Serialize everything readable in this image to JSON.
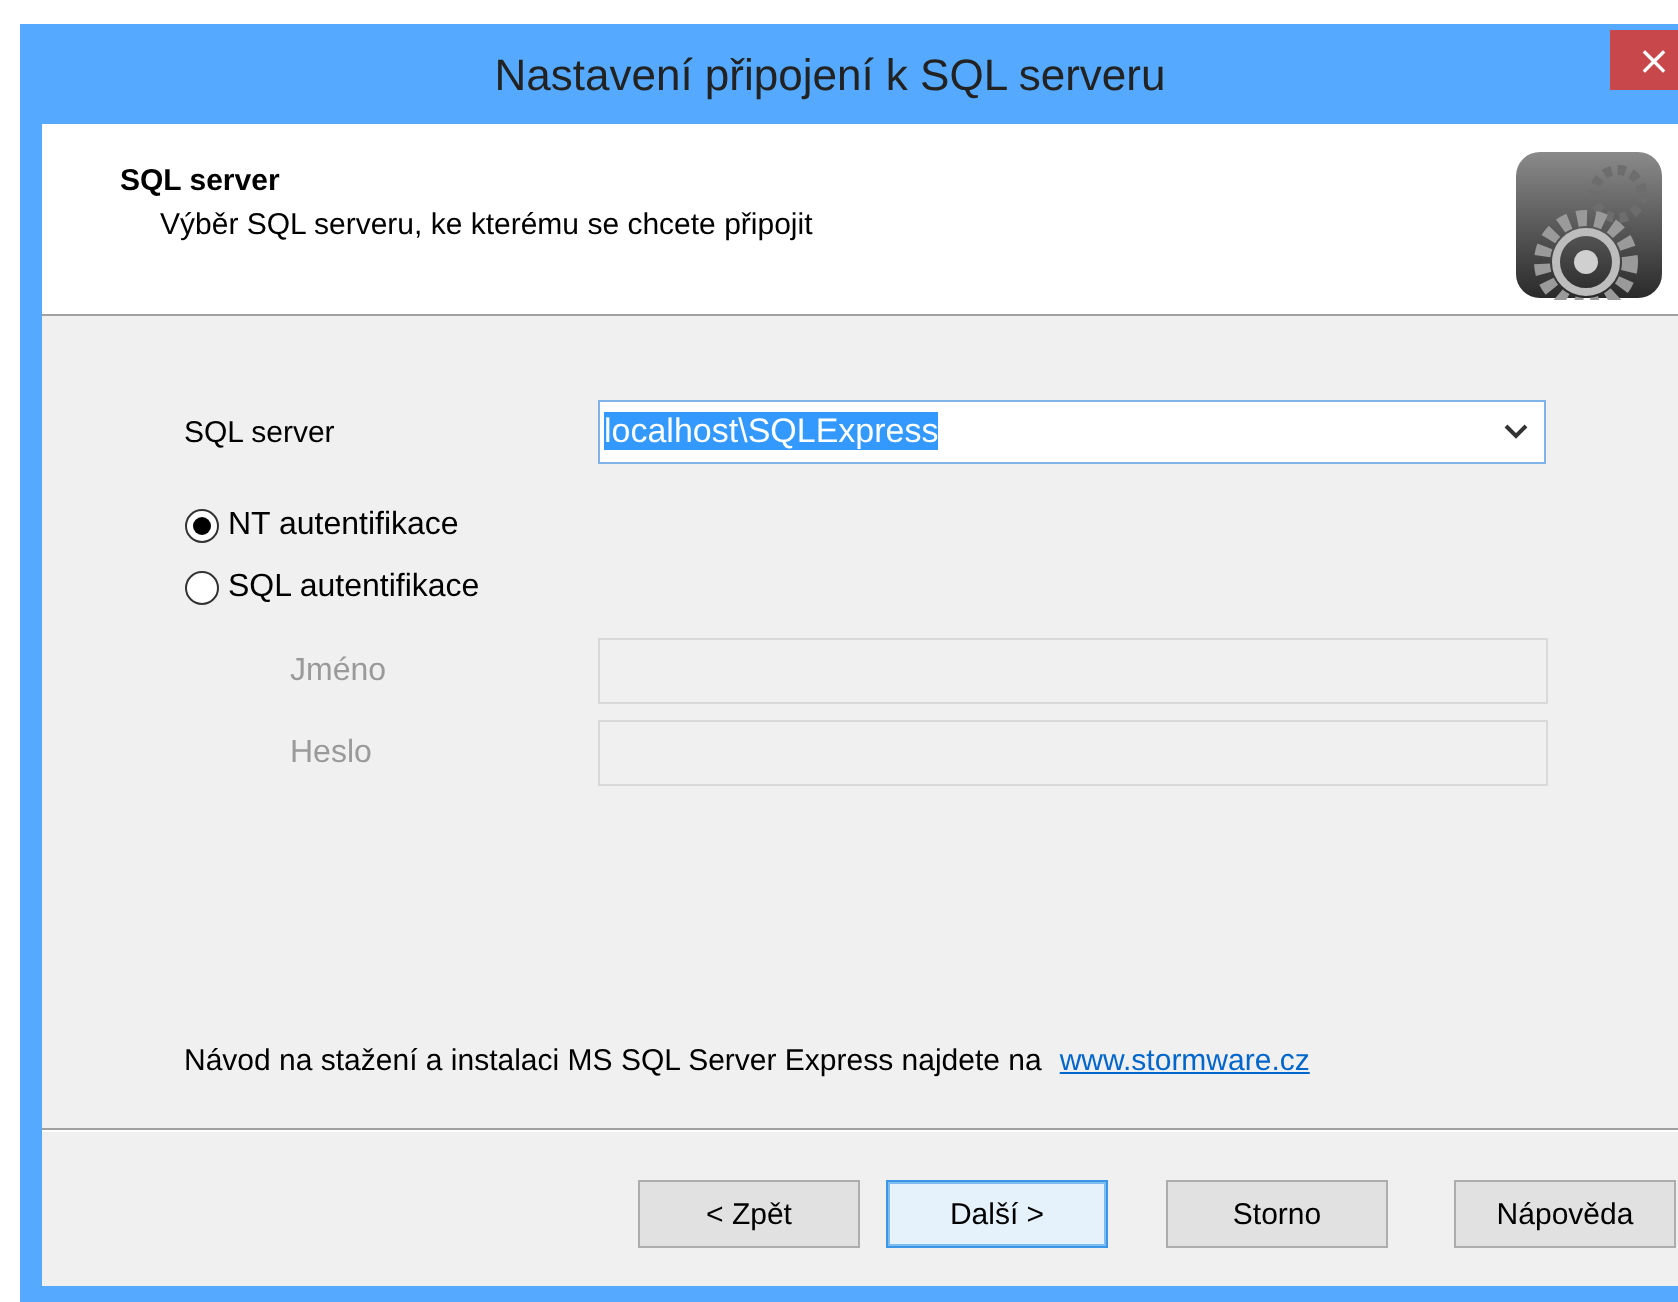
{
  "window": {
    "title": "Nastavení připojení k SQL serveru",
    "close": "×"
  },
  "header": {
    "title": "SQL server",
    "subtitle": "Výběr SQL serveru, ke kterému se chcete připojit"
  },
  "server": {
    "label": "SQL server",
    "value": "localhost\\SQLExpress",
    "text_selected": true
  },
  "auth_options": [
    {
      "label": "NT autentifikace",
      "selected": true
    },
    {
      "label": "SQL autentifikace",
      "selected": false
    }
  ],
  "credentials": [
    {
      "label": "Jméno",
      "disabled": true
    },
    {
      "label": "Heslo",
      "disabled": true
    }
  ],
  "note": {
    "text": "Návod na stažení a instalaci MS SQL Server Express najdete na",
    "link": "www.stormware.cz"
  },
  "buttons": [
    {
      "label": "< Zpět",
      "default": false
    },
    {
      "label": "Další >",
      "default": true
    },
    {
      "label": "Storno",
      "default": false
    },
    {
      "label": "Nápověda",
      "default": false
    }
  ]
}
